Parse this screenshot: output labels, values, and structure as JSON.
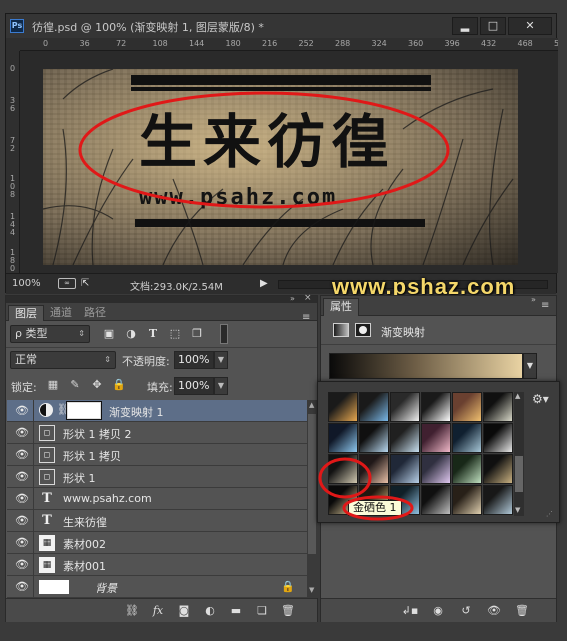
{
  "app": {
    "logo_text": "Ps"
  },
  "document": {
    "title": "彷徨.psd @ 100% (渐变映射 1, 图层蒙版/8) *",
    "zoom": "100%",
    "doc_size": "文档:293.0K/2.54M",
    "ruler_top": [
      "0",
      "36",
      "72",
      "108",
      "144",
      "180",
      "216",
      "252",
      "288",
      "324",
      "360",
      "396",
      "432",
      "468",
      "504"
    ],
    "ruler_left": [
      "0",
      "3 6",
      "7 2",
      "1 0 8",
      "1 4 4",
      "1 8 0"
    ],
    "canvas": {
      "title_text": "生来彷徨",
      "url_text": "www.psahz.com"
    }
  },
  "window_buttons": {
    "minimize": "▂",
    "maximize": "□",
    "close": "✕"
  },
  "watermark": "www.pshaz.com",
  "layers_panel": {
    "tabs": [
      "图层",
      "通道",
      "路径"
    ],
    "menu_icon": "≡",
    "kind_filter": "ρ 类型",
    "filter_icons": [
      "image-filter-icon",
      "adjustment-filter-icon",
      "type-filter-icon",
      "shape-filter-icon",
      "smart-object-filter-icon"
    ],
    "blend_mode": "正常",
    "opacity_label": "不透明度:",
    "opacity_value": "100%",
    "lock_label": "锁定:",
    "fill_label": "填充:",
    "fill_value": "100%",
    "layers": [
      {
        "name": "渐变映射 1",
        "type": "adjustment",
        "selected": true
      },
      {
        "name": "形状 1 拷贝 2",
        "type": "shape"
      },
      {
        "name": "形状 1 拷贝",
        "type": "shape"
      },
      {
        "name": "形状 1",
        "type": "shape"
      },
      {
        "name": "www.psahz.com",
        "type": "text"
      },
      {
        "name": "生来彷徨",
        "type": "text"
      },
      {
        "name": "素材002",
        "type": "smart"
      },
      {
        "name": "素材001",
        "type": "smart"
      },
      {
        "name": "背景",
        "type": "background",
        "locked": true
      }
    ],
    "footer_icons": [
      "link-layers-icon",
      "fx-icon",
      "add-mask-icon",
      "new-adjustment-icon",
      "new-group-icon",
      "new-layer-icon",
      "delete-layer-icon"
    ]
  },
  "properties_panel": {
    "tab": "属性",
    "title": "渐变映射",
    "gradient": {
      "start": "#0a0a0a",
      "end": "#e9d3a3"
    },
    "footer_icons": [
      "clip-to-layer-icon",
      "view-previous-icon",
      "reset-icon",
      "visibility-icon",
      "delete-icon"
    ]
  },
  "gradient_picker": {
    "tooltip": "金硒色 1",
    "columns": 6,
    "swatches": [
      [
        "#1a1a1a",
        "#e8a850"
      ],
      [
        "#1a1a1a",
        "#7ab8e8"
      ],
      [
        "#2a2a2a",
        "#f0f0f0"
      ],
      [
        "#1a1a1a",
        "#ffffff"
      ],
      [
        "#6a4030",
        "#f0c070"
      ],
      [
        "#101010",
        "#d8d8c8"
      ],
      [
        "#101828",
        "#8ec8f0"
      ],
      [
        "#101010",
        "#b8d8f0"
      ],
      [
        "#202020",
        "#c8e0f0"
      ],
      [
        "#402030",
        "#f0b8c8"
      ],
      [
        "#102030",
        "#a8c8d8"
      ],
      [
        "#0a0a0a",
        "#e8e8e8"
      ],
      [
        "#121212",
        "#d0c8b0"
      ],
      [
        "#201818",
        "#e8c0a8"
      ],
      [
        "#202838",
        "#b8d0e8"
      ],
      [
        "#303040",
        "#e0c8f0"
      ],
      [
        "#182818",
        "#c0e0c0"
      ],
      [
        "#101010",
        "#c8b080"
      ],
      [
        "#0a0a0a",
        "#e9d3a3"
      ],
      [
        "#201810",
        "#f0d090"
      ],
      [
        "#102028",
        "#90c0e0"
      ],
      [
        "#101010",
        "#c0c0c0"
      ],
      [
        "#282018",
        "#e0d0b0"
      ],
      [
        "#181818",
        "#b0c8d8"
      ]
    ]
  },
  "colors": {
    "annotation_red": "#e01818",
    "selection_blue": "#5d6e88",
    "watermark_yellow": "#f4d76a"
  }
}
